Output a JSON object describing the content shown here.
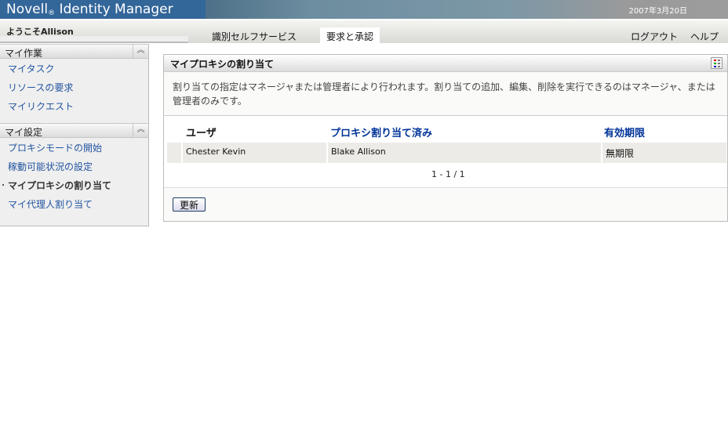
{
  "header": {
    "brand": "Novell",
    "brand_mark": "®",
    "product": "Identity Manager",
    "date": "2007年3月20日"
  },
  "nav": {
    "welcome": "ようこそAllison",
    "tabs": [
      {
        "label": "識別セルフサービス"
      },
      {
        "label": "要求と承認",
        "active": true
      }
    ],
    "logout": "ログアウト",
    "help": "ヘルプ"
  },
  "sidebar": {
    "sections": [
      {
        "title": "マイ作業",
        "items": [
          "マイタスク",
          "リソースの要求",
          "マイリクエスト"
        ]
      },
      {
        "title": "マイ設定",
        "items": [
          "プロキシモードの開始",
          "稼動可能状況の設定",
          "マイプロキシの割り当て",
          "マイ代理人割り当て"
        ],
        "current": 2
      }
    ],
    "collapse_icon": "double-chevron-up"
  },
  "panel": {
    "title": "マイプロキシの割り当て",
    "description": "割り当ての指定はマネージャまたは管理者により行われます。割り当ての追加、編集、削除を実行できるのはマネージャ、または管理者のみです。",
    "columns": [
      "ユーザ",
      "プロキシ割り当て済み",
      "有効期限"
    ],
    "rows": [
      [
        "Chester Kevin",
        "Blake Allison",
        "無期限"
      ]
    ],
    "pager": "1 - 1 / 1",
    "refresh": "更新"
  },
  "colors": {
    "brand": "#336699",
    "link": "#2255a0",
    "header_link": "#003399"
  }
}
